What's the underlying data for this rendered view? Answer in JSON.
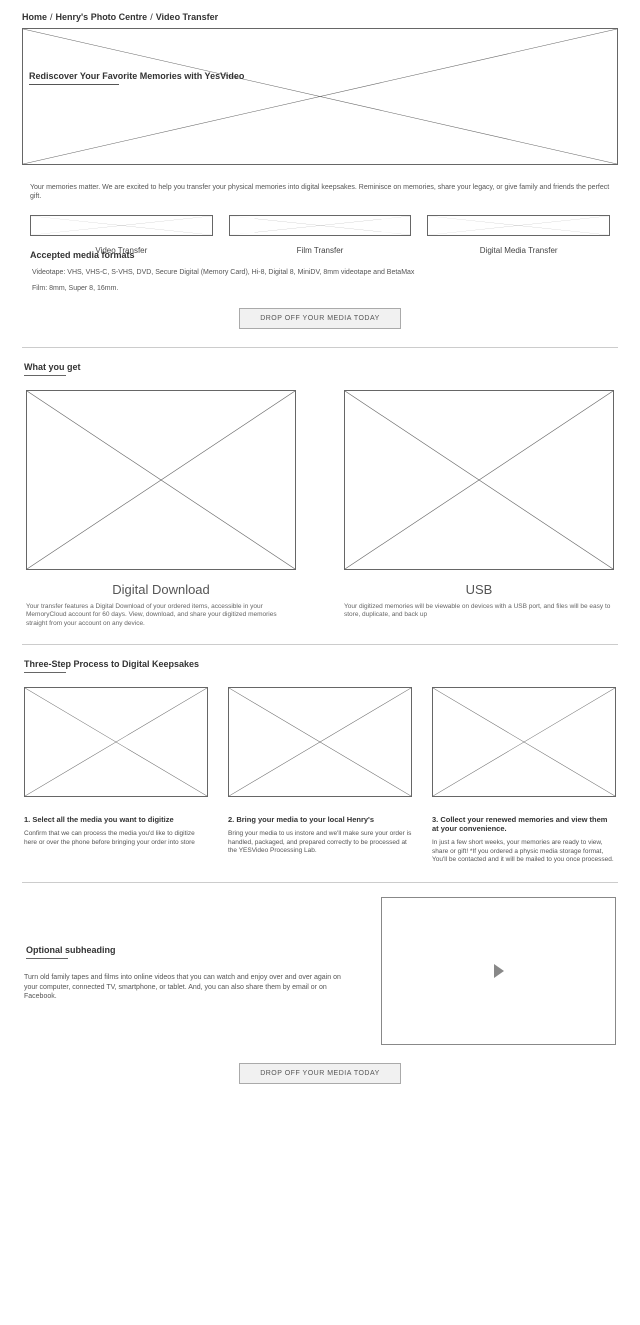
{
  "breadcrumb": {
    "home": "Home",
    "center": "Henry's Photo Centre",
    "page": "Video Transfer"
  },
  "hero": {
    "title": "Rediscover Your Favorite Memories with YesVideo"
  },
  "intro": "Your memories matter. We are excited to help you transfer your physical memories into digital keepsakes. Reminisce on memories, share your legacy, or give family and friends the perfect gift.",
  "services": [
    {
      "title": "Video Transfer"
    },
    {
      "title": "Film Transfer"
    },
    {
      "title": "Digital Media Transfer"
    }
  ],
  "accepted": {
    "heading": "Accepted media formats",
    "line1": "Videotape: VHS, VHS-C, S-VHS, DVD, Secure Digital (Memory Card), Hi-8, Digital 8, MiniDV, 8mm videotape and BetaMax",
    "line2": "Film: 8mm, Super 8, 16mm."
  },
  "cta": "DROP OFF YOUR MEDIA TODAY",
  "whatyouget": {
    "heading": "What you get",
    "items": [
      {
        "title": "Digital Download",
        "desc": "Your transfer features a Digital Download of your ordered items, accessible in your MemoryCloud account for 60 days. View, download, and share your digitized memories straight from your account on any device."
      },
      {
        "title": "USB",
        "desc": "Your digitized memories will be viewable on devices with a USB port, and files will be easy to store, duplicate, and back up"
      }
    ]
  },
  "process": {
    "heading": "Three-Step Process to Digital Keepsakes",
    "steps": [
      {
        "title": "1. Select all the media you want to digitize",
        "desc": "Confirm that we can process the media you'd like to digitize here or over the phone before bringing your order into store"
      },
      {
        "title": "2. Bring your media to your local Henry's",
        "desc": "Bring your media to us instore and we'll make sure your order is handled, packaged, and prepared correctly to be processed at the YESVideo Processing Lab."
      },
      {
        "title": "3. Collect your renewed memories and view them at your convenience.",
        "desc": "In just a few short weeks, your memories are ready to view, share or gift! *If you ordered a physic media storage format, You'll be contacted and it will be mailed to you once processed."
      }
    ]
  },
  "optional": {
    "heading": "Optional subheading",
    "desc": "Turn old family tapes and films into online videos that you can watch and enjoy over and over again on your computer, connected TV, smartphone, or tablet. And, you can also share them by email or on Facebook."
  }
}
